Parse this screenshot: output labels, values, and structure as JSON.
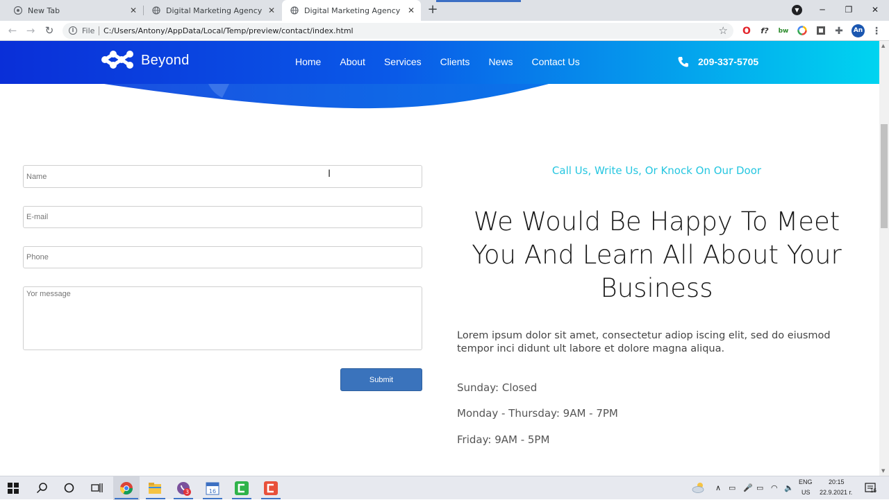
{
  "browser": {
    "tabs": [
      {
        "title": "New Tab",
        "active": false
      },
      {
        "title": "Digital Marketing Agency",
        "active": false
      },
      {
        "title": "Digital Marketing Agency",
        "active": true
      }
    ],
    "new_tab_label": "+",
    "close_glyph": "✕",
    "address": {
      "scheme_label": "File",
      "url": "C:/Users/Antony/AppData/Local/Temp/preview/contact/index.html"
    },
    "profile_initials": "An"
  },
  "site": {
    "brand": "Beyond",
    "nav": [
      "Home",
      "About",
      "Services",
      "Clients",
      "News",
      "Contact Us"
    ],
    "phone": "209-337-5705",
    "colors": {
      "header_gradient_start": "#0a2fd8",
      "header_gradient_end": "#00d4f0",
      "accent": "#25c6e0",
      "submit": "#3a73bc"
    }
  },
  "form": {
    "name_placeholder": "Name",
    "email_placeholder": "E-mail",
    "phone_placeholder": "Phone",
    "message_placeholder": "Yor message",
    "submit_label": "Submit"
  },
  "contact": {
    "tagline": "Call Us, Write Us, Or Knock On Our Door",
    "headline": "We Would Be Happy To Meet You And Learn All About Your Business",
    "intro": "Lorem ipsum dolor sit amet, consectetur adiop iscing elit, sed do eiusmod tempor inci didunt ult labore et dolore magna aliqua.",
    "hours": [
      "Sunday: Closed",
      "Monday - Thursday: 9AM - 7PM",
      "Friday: 9AM - 5PM"
    ]
  },
  "taskbar": {
    "language": "ENG",
    "region": "US",
    "time": "20:15",
    "date": "22.9.2021 г.",
    "viber_badge": "3",
    "notification_count": "16"
  }
}
